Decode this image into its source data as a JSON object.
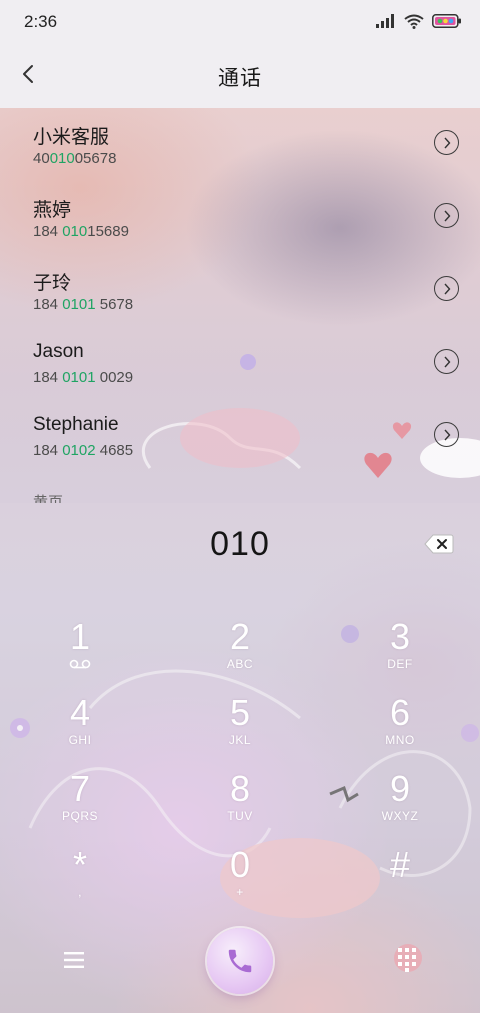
{
  "status": {
    "time": "2:36"
  },
  "header": {
    "title": "通话"
  },
  "contacts": [
    {
      "name": "小米客服",
      "number_pre": "40",
      "number_hl": "010",
      "number_post": "05678"
    },
    {
      "name": "燕婷",
      "number_pre": "184 ",
      "number_hl": "010",
      "number_post": "15689"
    },
    {
      "name": "子玲",
      "number_pre": "184 ",
      "number_hl": "0101",
      "number_post": " 5678"
    },
    {
      "name": "Jason",
      "number_pre": "184 ",
      "number_hl": "0101",
      "number_post": " 0029"
    },
    {
      "name": "Stephanie",
      "number_pre": "184 ",
      "number_hl": "0102",
      "number_post": " 4685"
    }
  ],
  "section_label": "黄页",
  "dialer": {
    "display": "010",
    "keys": [
      {
        "digit": "1",
        "letters": ""
      },
      {
        "digit": "2",
        "letters": "ABC"
      },
      {
        "digit": "3",
        "letters": "DEF"
      },
      {
        "digit": "4",
        "letters": "GHI"
      },
      {
        "digit": "5",
        "letters": "JKL"
      },
      {
        "digit": "6",
        "letters": "MNO"
      },
      {
        "digit": "7",
        "letters": "PQRS"
      },
      {
        "digit": "8",
        "letters": "TUV"
      },
      {
        "digit": "9",
        "letters": "WXYZ"
      },
      {
        "digit": "*",
        "letters": ","
      },
      {
        "digit": "0",
        "letters": "+"
      },
      {
        "digit": "#",
        "letters": ""
      }
    ]
  },
  "icons": {
    "back": "chevron-left-icon",
    "backspace": "backspace-icon",
    "menu": "menu-icon",
    "call": "phone-icon",
    "dialpad": "dialpad-icon",
    "voicemail": "voicemail-icon"
  },
  "colors": {
    "highlight": "#1fa463",
    "call_button": "#e6c7f3",
    "call_icon": "#a96bd3"
  }
}
